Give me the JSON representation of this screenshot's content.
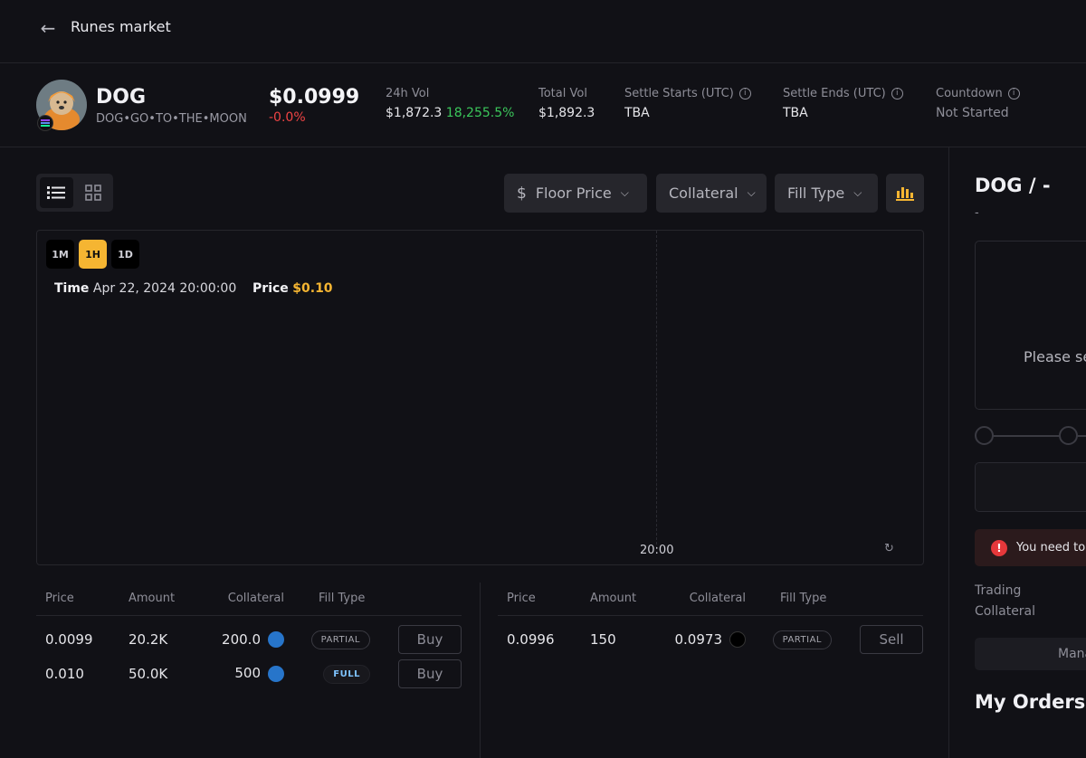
{
  "header": {
    "title": "Runes market"
  },
  "token": {
    "symbol": "DOG",
    "full_name": "DOG•GO•TO•THE•MOON",
    "price": "$0.0999",
    "change": "-0.0%",
    "stats": [
      {
        "label": "24h Vol",
        "value": "$1,872.3",
        "extra": "18,255.5%"
      },
      {
        "label": "Total Vol",
        "value": "$1,892.3"
      },
      {
        "label": "Settle Starts (UTC)",
        "value": "TBA"
      },
      {
        "label": "Settle Ends (UTC)",
        "value": "TBA"
      },
      {
        "label": "Countdown",
        "value": "Not Started"
      }
    ]
  },
  "filters": {
    "floor_price": "Floor Price",
    "collateral": "Collateral",
    "fill_type": "Fill Type"
  },
  "chart": {
    "timeframes": [
      "1M",
      "1H",
      "1D"
    ],
    "active_timeframe": "1H",
    "tooltip_time_label": "Time",
    "tooltip_time_value": "Apr 22, 2024 20:00:00",
    "tooltip_price_label": "Price",
    "tooltip_price_value": "$0.10",
    "x_tick": "20:00"
  },
  "orderbook": {
    "headers": [
      "Price",
      "Amount",
      "Collateral",
      "Fill Type"
    ],
    "buy_rows": [
      {
        "price": "0.0099",
        "amount": "20.2K",
        "collateral": "200.0",
        "fill": "PARTIAL",
        "action": "Buy"
      },
      {
        "price": "0.010",
        "amount": "50.0K",
        "collateral": "500",
        "fill": "FULL",
        "action": "Buy"
      }
    ],
    "sell_rows": [
      {
        "price": "0.0996",
        "amount": "150",
        "collateral": "0.0973",
        "fill": "PARTIAL",
        "action": "Sell"
      }
    ]
  },
  "right_panel": {
    "pair": "DOG / -",
    "sub": "-",
    "please": "Please se",
    "alert": "You need to",
    "trading_label": "Trading",
    "collateral_label": "Collateral",
    "manage": "Mana",
    "my_orders": "My Orders"
  }
}
